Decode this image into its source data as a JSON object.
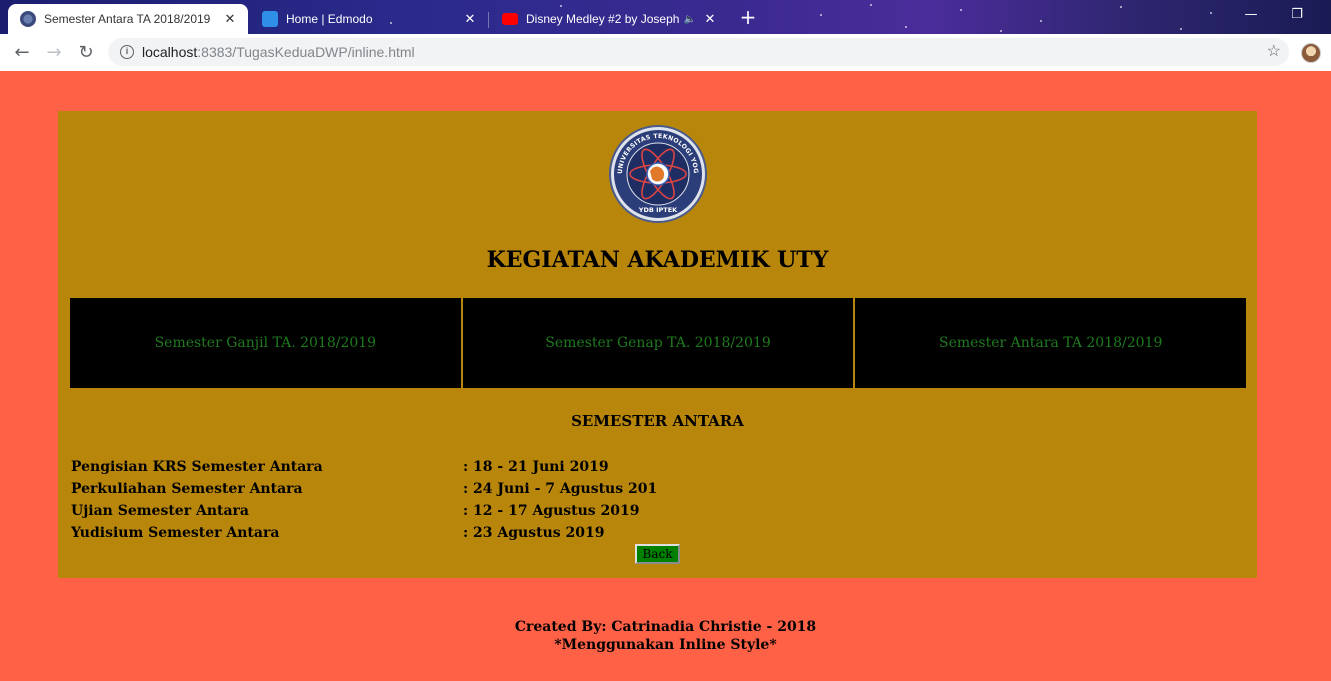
{
  "browser": {
    "tabs": [
      {
        "title": "Semester Antara TA 2018/2019",
        "active": true
      },
      {
        "title": "Home | Edmodo",
        "active": false
      },
      {
        "title": "Disney Medley #2 by Joseph",
        "active": false,
        "audio": true
      }
    ],
    "address": {
      "host": "localhost",
      "rest": ":8383/TugasKeduaDWP/inline.html"
    },
    "icons": [
      "back-icon",
      "forward-icon",
      "reload-icon",
      "info-icon",
      "bookmark-star-icon",
      "profile-avatar"
    ]
  },
  "colors": {
    "page_background": "#ff6147",
    "panel_background": "#b8860b",
    "menu_background": "#000000",
    "menu_text": "#1f7a1f",
    "back_button": "#008000"
  },
  "header": {
    "logo_name": "UNIVERSITAS TEKNOLOGI YOGYAKARTA",
    "logo_bottom": "YDB IPTEK",
    "title": "KEGIATAN AKADEMIK UTY"
  },
  "menu": [
    {
      "label": "Semester Ganjil TA. 2018/2019"
    },
    {
      "label": "Semester Genap TA. 2018/2019"
    },
    {
      "label": "Semester Antara TA 2018/2019"
    }
  ],
  "section": {
    "title": "SEMESTER ANTARA",
    "rows": [
      {
        "label": "Pengisian KRS Semester Antara",
        "value": ": 18 - 21 Juni 2019"
      },
      {
        "label": "Perkuliahan Semester Antara",
        "value": ": 24 Juni - 7 Agustus 201"
      },
      {
        "label": "Ujian Semester Antara",
        "value": ": 12 - 17 Agustus 2019"
      },
      {
        "label": "Yudisium Semester Antara",
        "value": ": 23 Agustus 2019"
      }
    ],
    "back_label": "Back"
  },
  "footer": {
    "line1": "Created By: Catrinadia Christie - 2018",
    "line2": "*Menggunakan Inline Style*"
  }
}
